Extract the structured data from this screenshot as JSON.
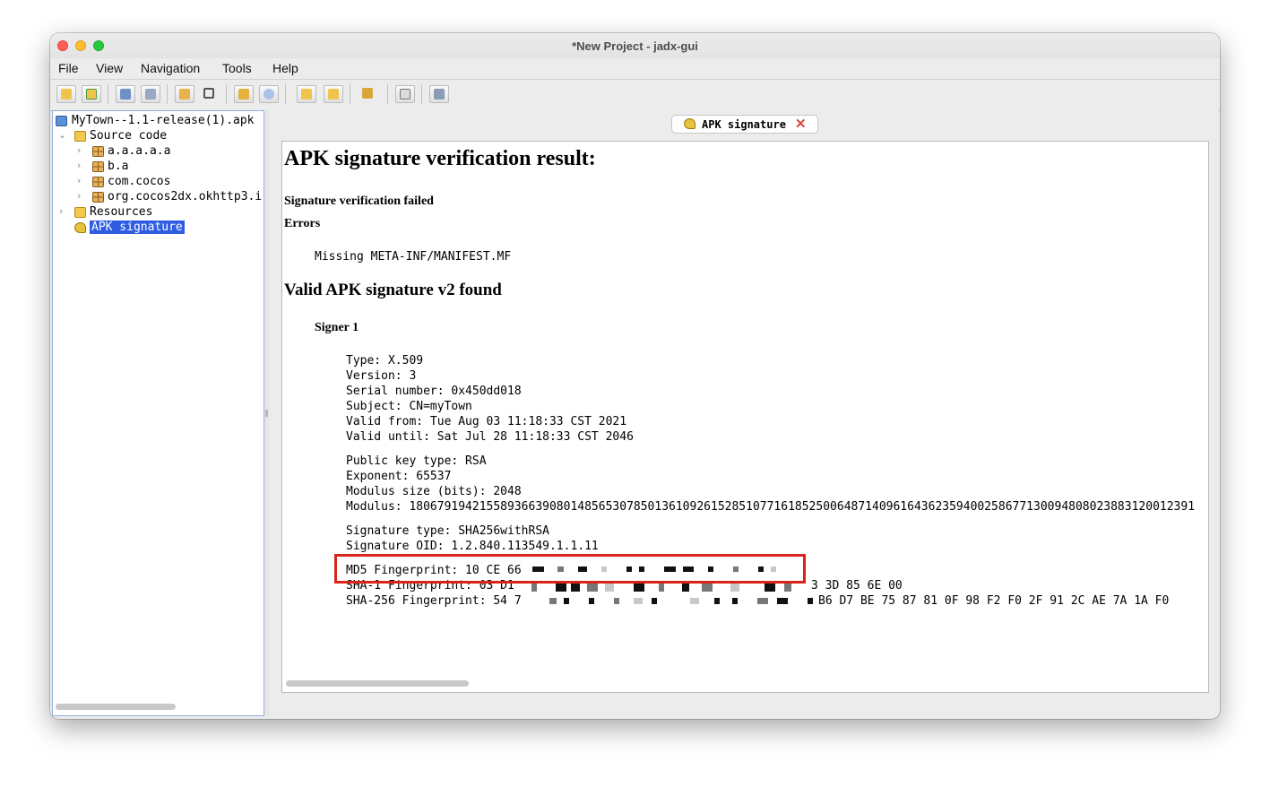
{
  "window": {
    "title": "*New Project - jadx-gui"
  },
  "menu": [
    "File",
    "View",
    "Navigation",
    "Tools",
    "Help"
  ],
  "toolbar": {
    "icons": [
      "open-file-icon",
      "add-files-icon",
      "save-all-icon",
      "export-icon",
      "sync-icon",
      "flatten-icon",
      "search-text-icon",
      "search-class-icon",
      "back-icon",
      "forward-icon",
      "deobfuscation-icon",
      "log-viewer-icon",
      "preferences-icon"
    ]
  },
  "tree": {
    "root": "MyTown--1.1-release(1).apk",
    "source_code": "Source code",
    "packages": [
      "a.a.a.a.a",
      "b.a",
      "com.cocos",
      "org.cocos2dx.okhttp3.i"
    ],
    "resources": "Resources",
    "apk_signature": "APK signature"
  },
  "tab": {
    "label": "APK signature"
  },
  "doc": {
    "heading": "APK signature verification result:",
    "status": "Signature verification failed",
    "errors_heading": "Errors",
    "error_1": "Missing META-INF/MANIFEST.MF",
    "valid_heading": "Valid APK signature v2 found",
    "signer": "Signer 1",
    "cert": [
      "Type: X.509",
      "Version: 3",
      "Serial number: 0x450dd018",
      "Subject: CN=myTown",
      "Valid from: Tue Aug 03 11:18:33 CST 2021",
      "Valid until: Sat Jul 28 11:18:33 CST 2046"
    ],
    "key": [
      "Public key type: RSA",
      "Exponent: 65537",
      "Modulus size (bits): 2048",
      "Modulus: 1806791942155893663908014856530785013610926152851077161852500648714096164362359400258677130094808023883120012391"
    ],
    "sig": [
      "Signature type: SHA256withRSA",
      "Signature OID: 1.2.840.113549.1.1.11"
    ],
    "md5": "MD5 Fingerprint: 10 CE 66",
    "sha1_prefix": "SHA-1 Fingerprint: 03 D1",
    "sha1_suffix": "3 3D 85 6E 00",
    "sha256_prefix": "SHA-256 Fingerprint: 54 7",
    "sha256_suffix": "B6 D7 BE 75 87 81 0F 98 F2 F0 2F 91 2C AE 7A 1A F0"
  },
  "colors": {
    "selection": "#2f5ce1",
    "highlight": "#d9241b",
    "tab_close": "#d9453d"
  }
}
